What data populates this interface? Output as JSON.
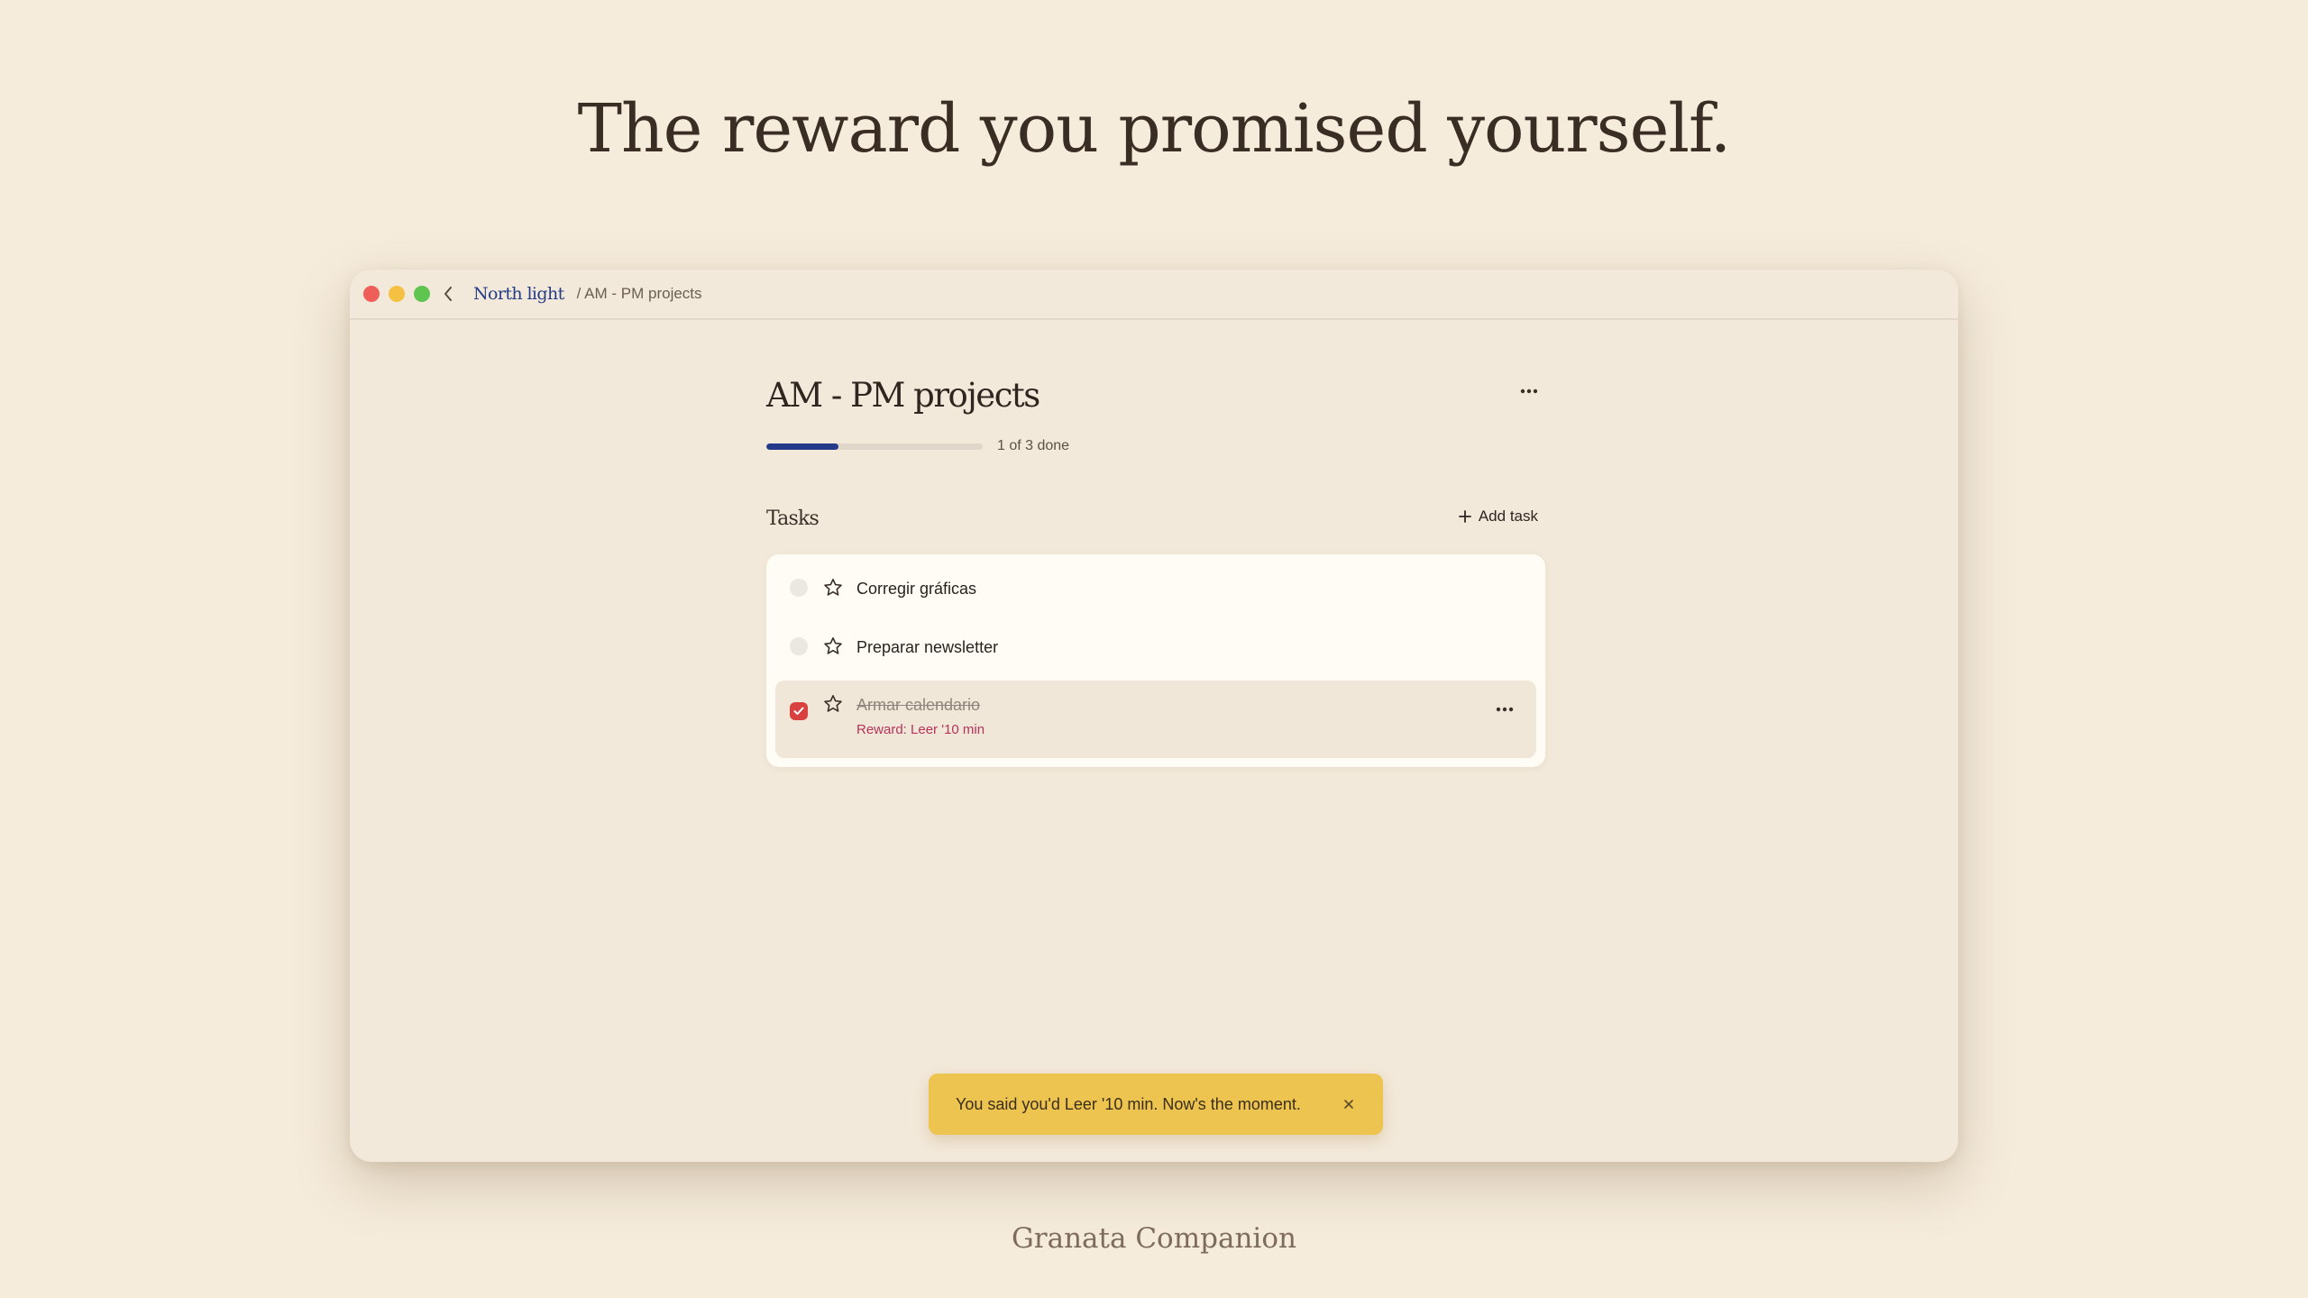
{
  "headline": "The reward you promised yourself.",
  "footer": "Granata Companion",
  "window": {
    "breadcrumb": {
      "home": "North light",
      "current": "/ AM - PM projects"
    }
  },
  "project": {
    "title": "AM - PM projects",
    "progress": {
      "fraction": 0.333,
      "label": "1 of 3 done"
    },
    "tasks_label": "Tasks",
    "add_task_label": "Add task",
    "tasks": [
      {
        "title": "Corregir gráficas",
        "done": false,
        "starred": false
      },
      {
        "title": "Preparar newsletter",
        "done": false,
        "starred": false
      },
      {
        "title": "Armar calendario",
        "done": true,
        "starred": false,
        "reward": "Reward: Leer '10 min"
      }
    ]
  },
  "toast": {
    "message": "You said you'd Leer '10 min. Now's the moment."
  },
  "colors": {
    "background": "#f6ecdc",
    "accent": "#253a8a",
    "check": "#d8413f",
    "reward": "#b8325a",
    "toast": "#ecc44f"
  },
  "icons": [
    "back-chevron-icon",
    "more-horizontal-icon",
    "plus-icon",
    "star-icon",
    "check-icon",
    "close-icon"
  ]
}
